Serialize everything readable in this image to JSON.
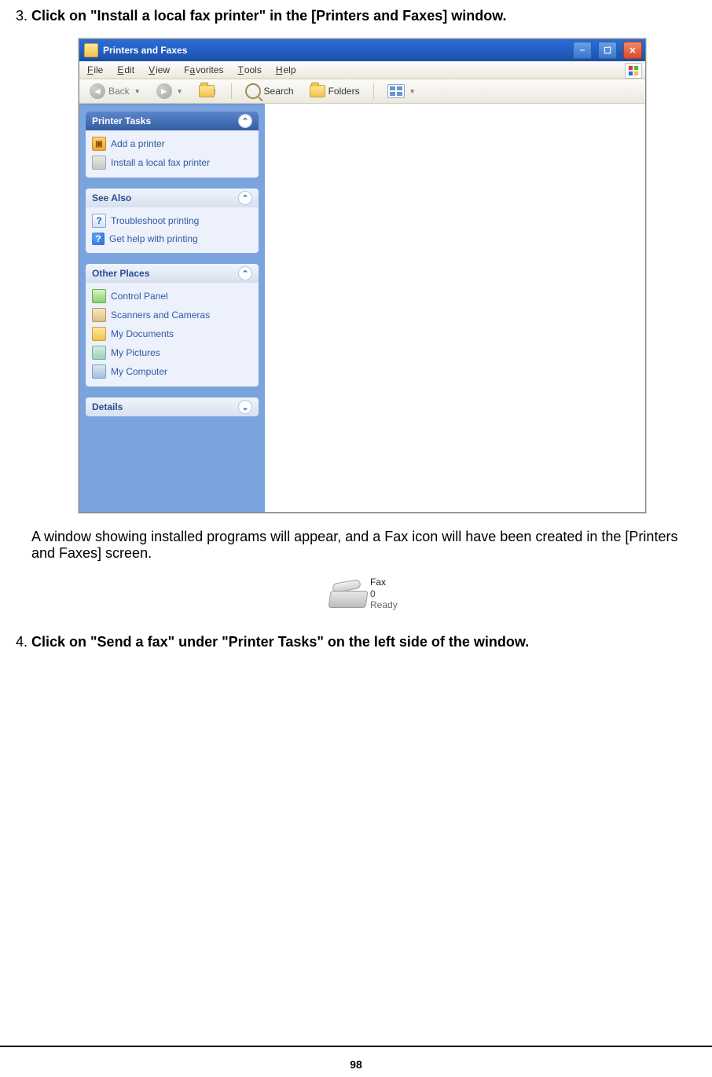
{
  "steps": {
    "s3_num": "3.",
    "s3_heading": "Click on \"Install a local fax printer\" in the [Printers and Faxes] window.",
    "s3_result": "A window showing installed programs will appear, and a Fax icon will have been created in the [Printers and Faxes] screen.",
    "s4_num": "4.",
    "s4_heading": "Click on \"Send a fax\" under \"Printer Tasks\" on the left side of the window."
  },
  "window": {
    "title": "Printers and Faxes",
    "btn_min": "–",
    "btn_max": "☐",
    "btn_close": "✕"
  },
  "menu": {
    "file_u": "F",
    "file_r": "ile",
    "edit_u": "E",
    "edit_r": "dit",
    "view_u": "V",
    "view_r": "iew",
    "fav_u": "a",
    "fav_pre": "F",
    "fav_r": "vorites",
    "tools_u": "T",
    "tools_r": "ools",
    "help_u": "H",
    "help_r": "elp"
  },
  "toolbar": {
    "back": "Back",
    "search": "Search",
    "folders": "Folders"
  },
  "taskpane": {
    "printer_tasks": {
      "title": "Printer Tasks",
      "items": [
        {
          "icon": "ic-orange",
          "label": "Add a printer"
        },
        {
          "icon": "ic-grey",
          "label": "Install a local fax printer"
        }
      ]
    },
    "see_also": {
      "title": "See Also",
      "items": [
        {
          "icon": "ic-blueq",
          "glyph": "?",
          "label": "Troubleshoot printing"
        },
        {
          "icon": "ic-bluec",
          "glyph": "?",
          "label": "Get help with printing"
        }
      ]
    },
    "other_places": {
      "title": "Other Places",
      "items": [
        {
          "icon": "ic-green",
          "label": "Control Panel"
        },
        {
          "icon": "ic-tan",
          "label": "Scanners and Cameras"
        },
        {
          "icon": "ic-folder",
          "label": "My Documents"
        },
        {
          "icon": "ic-teal",
          "label": "My Pictures"
        },
        {
          "icon": "ic-monitor",
          "label": "My Computer"
        }
      ]
    },
    "details": {
      "title": "Details"
    },
    "chevron_up": "⌃",
    "chevron_down": "⌄"
  },
  "fax": {
    "name": "Fax",
    "line2": "0",
    "status": "Ready"
  },
  "pageNumber": "98"
}
